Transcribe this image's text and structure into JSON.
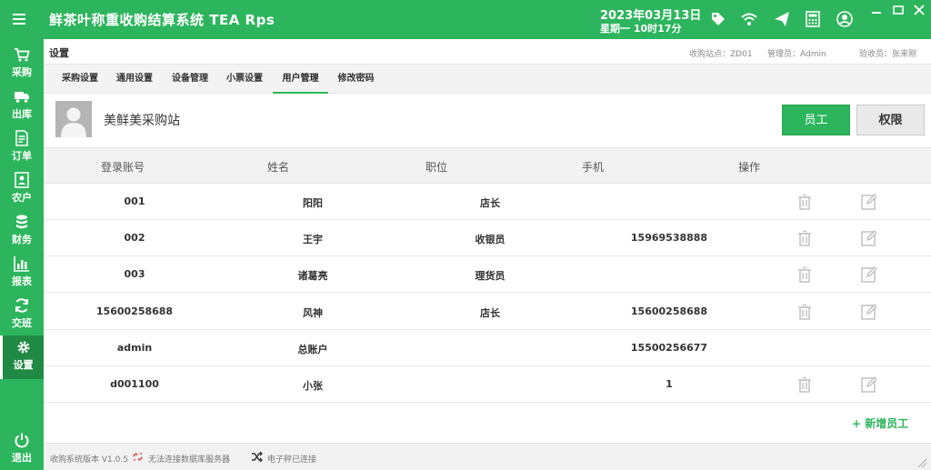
{
  "app": {
    "title": "鲜茶叶称重收购结算系统  TEA  Rps",
    "date": "2023年03月13日",
    "weekday_time": "星期一   10时17分",
    "accent_color": "#2db55d"
  },
  "topbar_icons": [
    "tag-icon",
    "wifi-icon",
    "send-icon",
    "calculator-icon",
    "user-circle-icon"
  ],
  "sidebar": {
    "items": [
      {
        "label": "采购",
        "icon": "cart-icon"
      },
      {
        "label": "出库",
        "icon": "truck-icon"
      },
      {
        "label": "订单",
        "icon": "order-icon"
      },
      {
        "label": "农户",
        "icon": "farmer-icon"
      },
      {
        "label": "财务",
        "icon": "finance-icon"
      },
      {
        "label": "报表",
        "icon": "chart-icon"
      },
      {
        "label": "交班",
        "icon": "shift-icon"
      },
      {
        "label": "设置",
        "icon": "gear-icon"
      }
    ],
    "active_index": 7,
    "logout_label": "退出"
  },
  "header": {
    "page_title": "设置",
    "station_code": "收购站点：ZD01",
    "admin": "管理员：Admin",
    "receiver": "验收员：张来刚"
  },
  "tabs": [
    {
      "label": "采购设置"
    },
    {
      "label": "通用设置"
    },
    {
      "label": "设备管理"
    },
    {
      "label": "小票设置"
    },
    {
      "label": "用户管理"
    },
    {
      "label": "修改密码"
    }
  ],
  "active_tab": 4,
  "station": {
    "name": "美鲜美采购站",
    "staff_button": "员工",
    "permission_button": "权限"
  },
  "table": {
    "columns": [
      "登录账号",
      "姓名",
      "职位",
      "手机",
      "操作"
    ],
    "rows": [
      {
        "account": "001",
        "name": "阳阳",
        "position": "店长",
        "phone": "",
        "actions": true
      },
      {
        "account": "002",
        "name": "王宇",
        "position": "收银员",
        "phone": "15969538888",
        "actions": true
      },
      {
        "account": "003",
        "name": "诸葛亮",
        "position": "理货员",
        "phone": "",
        "actions": true
      },
      {
        "account": "15600258688",
        "name": "风神",
        "position": "店长",
        "phone": "15600258688",
        "actions": true
      },
      {
        "account": "admin",
        "name": "总账户",
        "position": "",
        "phone": "15500256677",
        "actions": false
      },
      {
        "account": "d001100",
        "name": "小张",
        "position": "",
        "phone": "1",
        "actions": true
      }
    ]
  },
  "add_user_label": "+  新增员工",
  "statusbar": {
    "version": "收购系统版本 V1.0.5",
    "db_status": "无法连接数据库服务器",
    "scale_status": "电子秤已连接"
  }
}
